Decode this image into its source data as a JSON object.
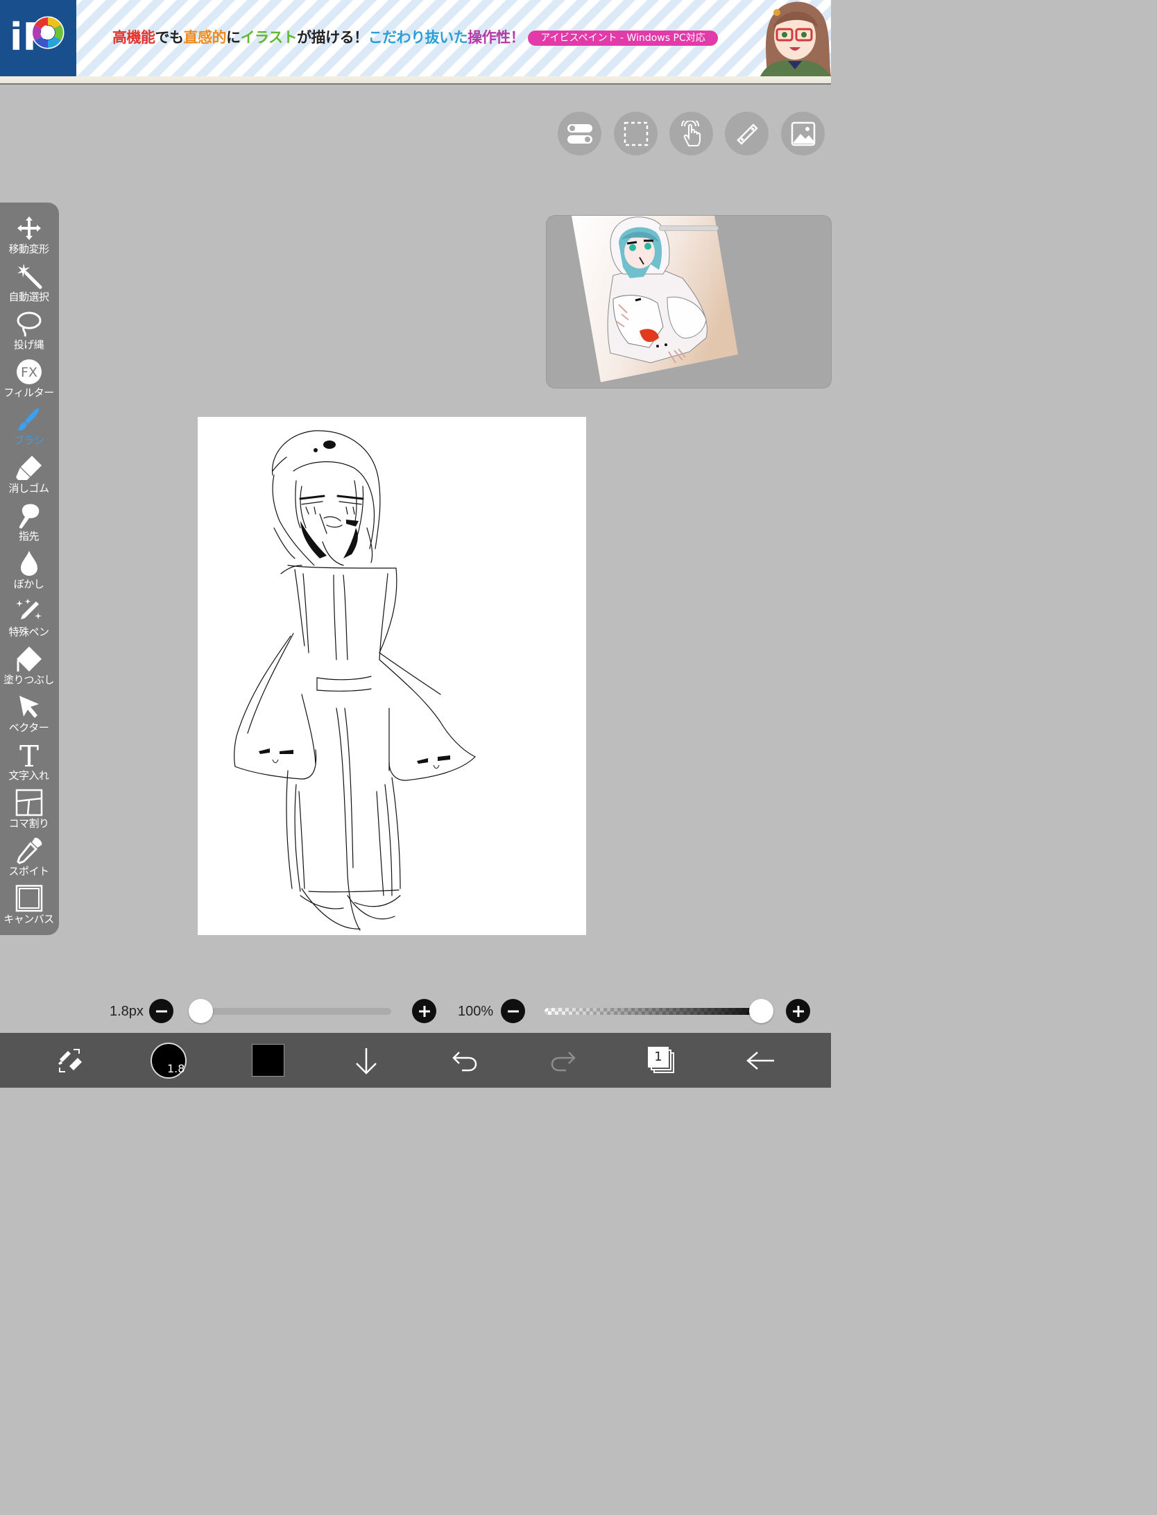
{
  "ad_banner": {
    "logo_text": "iP",
    "headline": {
      "part1": "高機能",
      "part2": "でも",
      "part3": "直感的",
      "part4": "に",
      "part5": "イラスト",
      "part6": "が描ける！",
      "part7": "こだわり抜いた",
      "part8": "操作性！"
    },
    "pill_label": "アイビスペイント - Windows PC対応"
  },
  "top_tools": [
    {
      "name": "toggle-icon"
    },
    {
      "name": "selection-icon"
    },
    {
      "name": "touch-gesture-icon"
    },
    {
      "name": "ruler-icon"
    },
    {
      "name": "reference-image-icon"
    }
  ],
  "toolbar": {
    "items": [
      {
        "label": "移動変形",
        "icon": "move-transform-icon"
      },
      {
        "label": "自動選択",
        "icon": "magic-wand-icon"
      },
      {
        "label": "投げ縄",
        "icon": "lasso-icon"
      },
      {
        "label": "フィルター",
        "icon": "fx-filter-icon",
        "icon_text": "FX"
      },
      {
        "label": "ブラシ",
        "icon": "brush-icon",
        "active": true
      },
      {
        "label": "消しゴム",
        "icon": "eraser-icon"
      },
      {
        "label": "指先",
        "icon": "finger-smudge-icon"
      },
      {
        "label": "ぼかし",
        "icon": "blur-drop-icon"
      },
      {
        "label": "特殊ペン",
        "icon": "special-pen-icon"
      },
      {
        "label": "塗りつぶし",
        "icon": "fill-bucket-icon"
      },
      {
        "label": "ベクター",
        "icon": "vector-cursor-icon"
      },
      {
        "label": "文字入れ",
        "icon": "text-tool-icon",
        "icon_text": "T"
      },
      {
        "label": "コマ割り",
        "icon": "frame-divider-icon"
      },
      {
        "label": "スポイト",
        "icon": "eyedropper-icon"
      },
      {
        "label": "キャンバス",
        "icon": "canvas-icon"
      }
    ],
    "active_color": "#3aa0ef"
  },
  "sliders": {
    "brush_size_label": "1.8px",
    "brush_size_fraction": 0.0,
    "opacity_label": "100%",
    "opacity_fraction": 1.0
  },
  "bottom_bar": {
    "tool_swap_icon": "brush-eraser-swap-icon",
    "brush_preview_value": "1.8",
    "color_swatch": "#000000",
    "import_icon": "arrow-down-icon",
    "undo_icon": "undo-icon",
    "redo_icon": "redo-icon",
    "layer_count": "1",
    "back_icon": "arrow-left-icon"
  },
  "colors": {
    "workspace_bg": "#bdbdbd",
    "toolbar_bg": "#7a7a7a",
    "bottom_bar_bg": "#555555"
  }
}
